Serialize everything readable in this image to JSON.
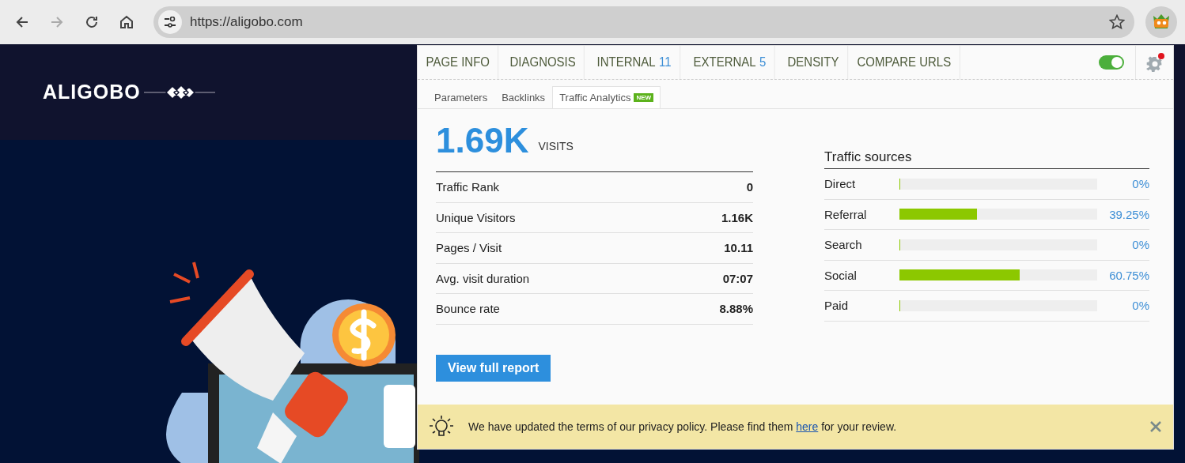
{
  "browser": {
    "url": "https://aligobo.com",
    "forward_disabled": true
  },
  "site": {
    "logo": "ALIGOBO"
  },
  "popup": {
    "tabs": [
      {
        "label": "PAGE INFO",
        "selected": false
      },
      {
        "label": "DIAGNOSIS",
        "selected": false
      },
      {
        "label": "INTERNAL",
        "count": "11",
        "selected": false
      },
      {
        "label": "EXTERNAL",
        "count": "5",
        "selected": false
      },
      {
        "label": "DENSITY",
        "selected": false
      },
      {
        "label": "COMPARE URLS",
        "selected": false
      }
    ],
    "toggle": {
      "on": true
    },
    "settings": {
      "has_notification": true
    },
    "subtabs": [
      {
        "label": "Parameters",
        "selected": false
      },
      {
        "label": "Backlinks",
        "selected": false
      },
      {
        "label": "Traffic Analytics",
        "badge": "NEW",
        "selected": true
      }
    ],
    "visits": {
      "value": "1.69K",
      "label": "VISITS"
    },
    "metrics": [
      {
        "label": "Traffic Rank",
        "value": "0"
      },
      {
        "label": "Unique Visitors",
        "value": "1.16K"
      },
      {
        "label": "Pages / Visit",
        "value": "10.11"
      },
      {
        "label": "Avg. visit duration",
        "value": "07:07"
      },
      {
        "label": "Bounce rate",
        "value": "8.88%"
      }
    ],
    "traffic_sources": {
      "title": "Traffic sources",
      "rows": [
        {
          "label": "Direct",
          "level": 0,
          "reading": "0%"
        },
        {
          "label": "Referral",
          "level": 0.3925,
          "reading": "39.25%"
        },
        {
          "label": "Search",
          "level": 0,
          "reading": "0%"
        },
        {
          "label": "Social",
          "level": 0.6075,
          "reading": "60.75%"
        },
        {
          "label": "Paid",
          "level": 0,
          "reading": "0%"
        }
      ]
    },
    "button": "View full report",
    "notice": {
      "before": "We have updated the terms of our privacy policy. Please find them ",
      "link": "here",
      "after": " for your review."
    }
  }
}
